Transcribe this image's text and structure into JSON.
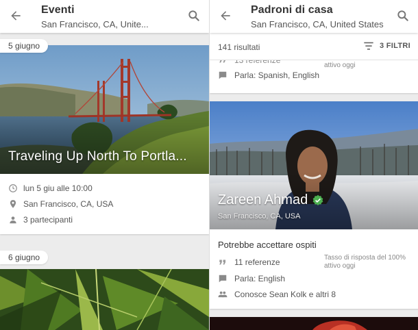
{
  "left": {
    "header": {
      "title": "Eventi",
      "subtitle": "San Francisco, CA, Unite..."
    },
    "events": [
      {
        "date": "5 giugno",
        "title": "Traveling Up North To Portla...",
        "when": "lun 5 giu alle 10:00",
        "where": "San Francisco, CA, USA",
        "participants": "3 partecipanti"
      },
      {
        "date": "6 giugno"
      }
    ]
  },
  "right": {
    "header": {
      "title": "Padroni di casa",
      "subtitle": "San Francisco, CA, United States"
    },
    "results": "141 risultati",
    "filters_label": "3 FILTRI",
    "prev_host": {
      "references": "13 referenze",
      "activity": "attivo oggi",
      "languages": "Parla: Spanish, English"
    },
    "host": {
      "name": "Zareen Ahmad",
      "location": "San Francisco, CA, USA",
      "accepting": "Potrebbe accettare ospiti",
      "references": "11 referenze",
      "response_rate": "Tasso di risposta del 100%",
      "activity": "attivo oggi",
      "languages": "Parla: English",
      "mutual": "Conosce Sean Kolk e altri 8"
    }
  },
  "colors": {
    "verified_green": "#4caf50",
    "icon_gray": "#8a8a8a"
  }
}
